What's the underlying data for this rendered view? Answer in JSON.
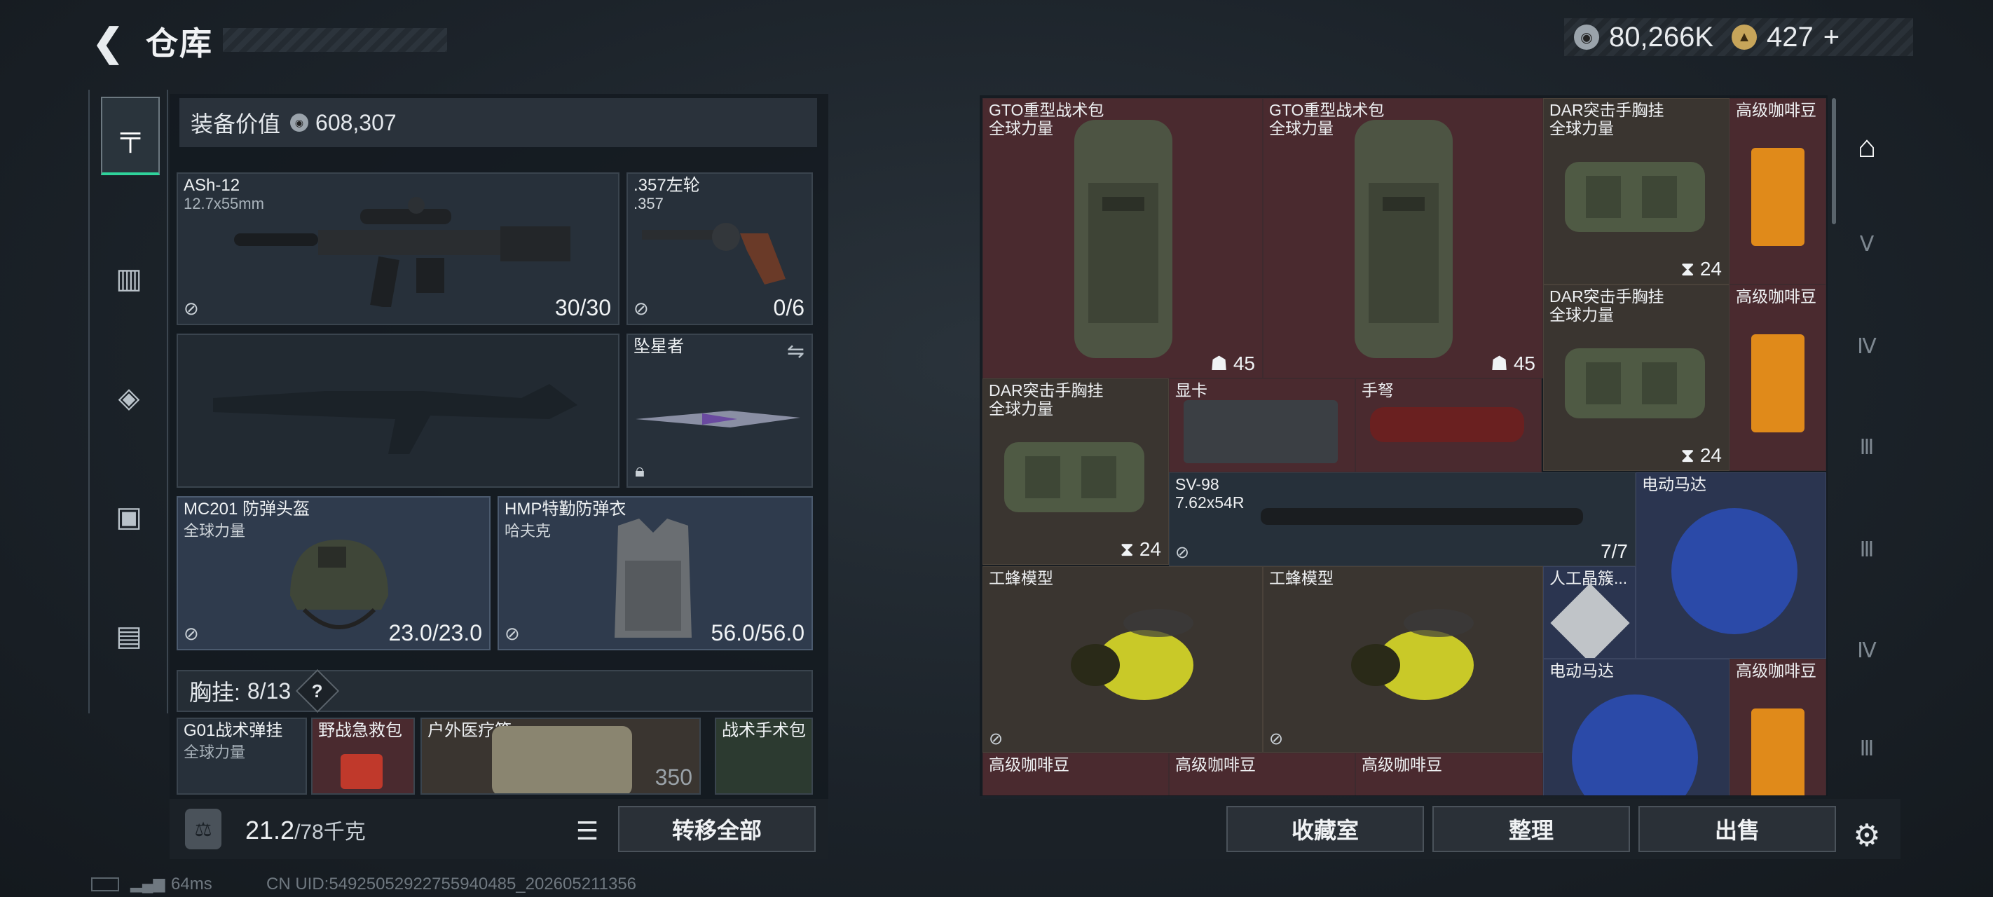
{
  "header": {
    "back_icon": "chevron-left-icon",
    "title": "仓库"
  },
  "currency": {
    "silver": "80,266K",
    "gold": "427",
    "plus": "+"
  },
  "left_rail": [
    {
      "icon": "pistol-icon",
      "active": true
    },
    {
      "icon": "vest-icon",
      "active": false
    },
    {
      "icon": "backpack-icon",
      "active": false
    },
    {
      "icon": "case-icon",
      "active": false
    },
    {
      "icon": "toolbox-icon",
      "active": false
    }
  ],
  "equipment": {
    "value_label": "装备价值",
    "value": "608,307",
    "slots": {
      "primary": {
        "name": "ASh-12",
        "sub": "12.7x55mm",
        "count": "30/30"
      },
      "sidearm": {
        "name": ".357左轮",
        "sub": ".357",
        "count": "0/6"
      },
      "melee": {
        "name": "坠星者"
      },
      "helmet": {
        "name": "MC201 防弹头盔",
        "sub": "全球力量",
        "count": "23.0/23.0"
      },
      "armor": {
        "name": "HMP特勤防弹衣",
        "sub": "哈夫克",
        "count": "56.0/56.0"
      }
    },
    "chest_rig_label": "胸挂:",
    "chest_rig_count": "8/13",
    "help": "?",
    "rig_items": [
      {
        "name": "G01战术弹挂",
        "sub": "全球力量"
      },
      {
        "name": "野战急救包"
      },
      {
        "name": "户外医疗箱",
        "count": "350"
      },
      {
        "name": "战术手术包"
      }
    ]
  },
  "weight": {
    "current": "21.2",
    "max": "/78千克"
  },
  "transfer_all": "转移全部",
  "stash": [
    {
      "name": "GTO重型战术包",
      "sub": "全球力量",
      "count": "45",
      "color": "#4a2a2f"
    },
    {
      "name": "GTO重型战术包",
      "sub": "全球力量",
      "count": "45",
      "color": "#4a2a2f"
    },
    {
      "name": "DAR突击手胸挂",
      "sub": "全球力量",
      "count": "24"
    },
    {
      "name": "高级咖啡豆"
    },
    {
      "name": "DAR突击手胸挂",
      "sub": "全球力量",
      "count": "24"
    },
    {
      "name": "高级咖啡豆"
    },
    {
      "name": "DAR突击手胸挂",
      "sub": "全球力量",
      "count": "24"
    },
    {
      "name": "显卡"
    },
    {
      "name": "手弩"
    },
    {
      "name": "SV-98",
      "sub": "7.62x54R",
      "count": "7/7"
    },
    {
      "name": "电动马达"
    },
    {
      "name": "工蜂模型"
    },
    {
      "name": "工蜂模型"
    },
    {
      "name": "人工晶簇..."
    },
    {
      "name": "电动马达"
    },
    {
      "name": "高级咖啡豆"
    },
    {
      "name": "高级咖啡豆"
    },
    {
      "name": "高级咖啡豆"
    },
    {
      "name": "高级咖啡豆"
    }
  ],
  "actions": {
    "collection": "收藏室",
    "sort": "整理",
    "sell": "出售"
  },
  "status": {
    "ping": "64ms",
    "uid": "CN UID:5492505292275594048​5_202605211356"
  }
}
